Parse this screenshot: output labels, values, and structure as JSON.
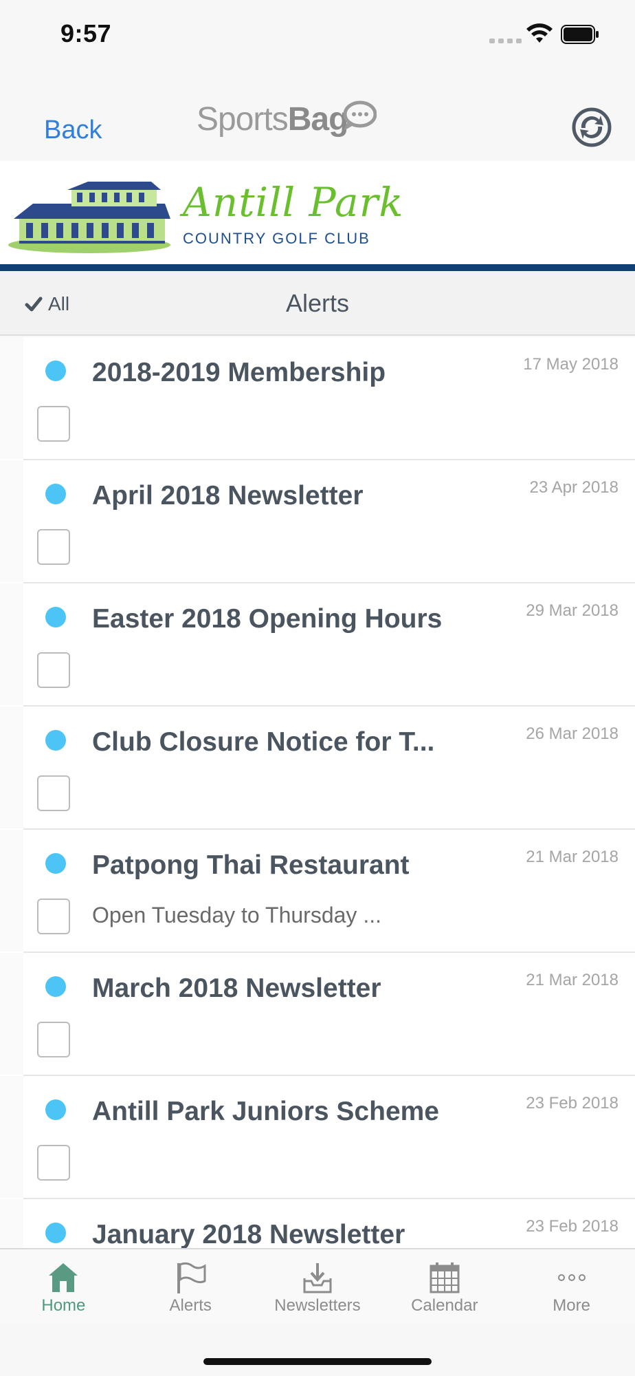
{
  "status_bar": {
    "time": "9:57"
  },
  "nav": {
    "back_label": "Back",
    "brand_light": "Sports",
    "brand_bold": "Bag"
  },
  "club": {
    "name": "Antill Park",
    "subtitle": "COUNTRY GOLF CLUB",
    "name_color": "#6abf2e",
    "subtitle_color": "#1f4f8f"
  },
  "alerts_header": {
    "select_all_label": "All",
    "title": "Alerts"
  },
  "alerts": [
    {
      "title": "2018-2019 Membership",
      "date": "17 May 2018",
      "preview": ""
    },
    {
      "title": "April 2018 Newsletter",
      "date": "23 Apr 2018",
      "preview": ""
    },
    {
      "title": "Easter 2018 Opening Hours",
      "date": "29 Mar 2018",
      "preview": ""
    },
    {
      "title": "Club Closure Notice for T...",
      "date": "26 Mar 2018",
      "preview": ""
    },
    {
      "title": "Patpong Thai Restaurant",
      "date": "21 Mar 2018",
      "preview": "Open Tuesday to Thursday ..."
    },
    {
      "title": "March 2018 Newsletter",
      "date": "21 Mar 2018",
      "preview": ""
    },
    {
      "title": "Antill Park Juniors Scheme",
      "date": "23 Feb 2018",
      "preview": ""
    },
    {
      "title": "January 2018 Newsletter",
      "date": "23 Feb 2018",
      "preview": ""
    }
  ],
  "tabs": [
    {
      "label": "Home",
      "icon": "home-icon",
      "active": true
    },
    {
      "label": "Alerts",
      "icon": "flag-icon",
      "active": false
    },
    {
      "label": "Newsletters",
      "icon": "inbox-icon",
      "active": false
    },
    {
      "label": "Calendar",
      "icon": "calendar-icon",
      "active": false
    },
    {
      "label": "More",
      "icon": "more-icon",
      "active": false
    }
  ],
  "colors": {
    "accent_blue": "#2f7fdc",
    "unread_dot": "#4cc4f5",
    "active_tab": "#4d9a7c",
    "banner_rule": "#123f73"
  }
}
